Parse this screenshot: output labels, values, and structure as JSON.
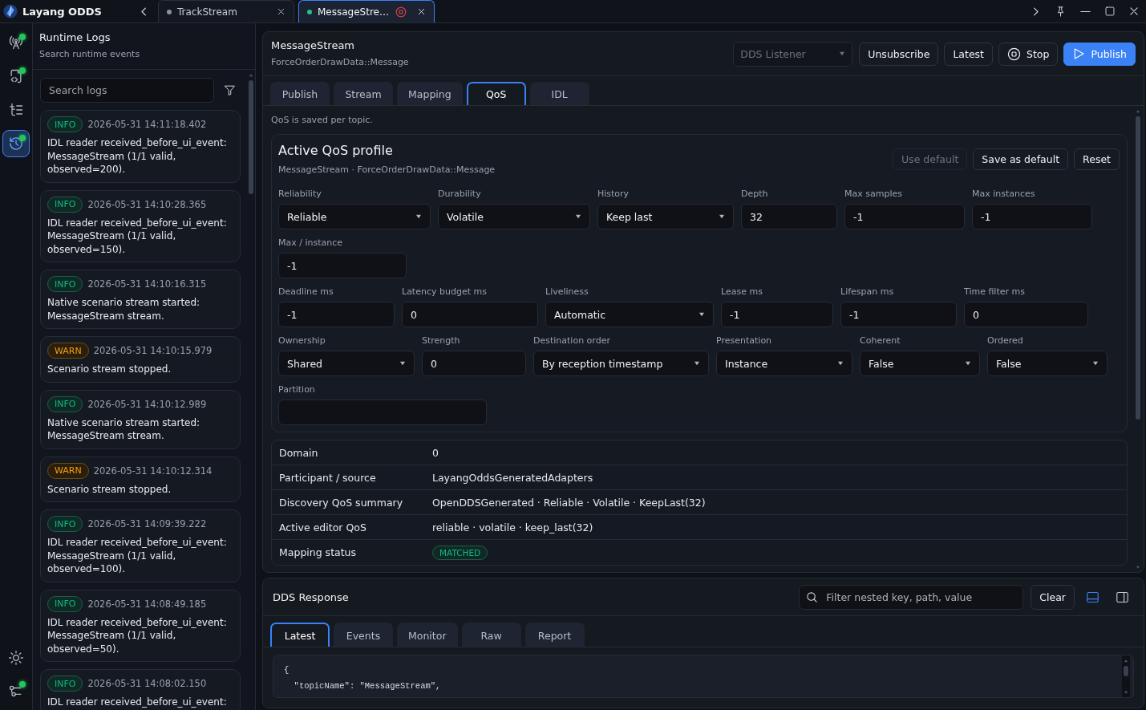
{
  "app": {
    "title": "Layang ODDS"
  },
  "tabs": [
    {
      "label": "TrackStream",
      "selected": false,
      "color": "#8b929e",
      "live": false
    },
    {
      "label": "MessageStre…",
      "selected": true,
      "color": "#22c08a",
      "live": true
    }
  ],
  "rail": {
    "items": [
      {
        "kind": "antenna",
        "selected": false,
        "badge": true
      },
      {
        "kind": "code",
        "selected": false,
        "badge": true
      },
      {
        "kind": "list",
        "selected": false,
        "badge": false
      },
      {
        "kind": "history",
        "selected": true,
        "badge": true
      }
    ],
    "footer": [
      {
        "kind": "settings",
        "selected": false,
        "badge": false
      },
      {
        "kind": "nodes",
        "selected": false,
        "badge": true
      }
    ]
  },
  "logs": {
    "title": "Runtime Logs",
    "subtitle": "Search runtime events",
    "search": {
      "placeholder": "Search logs"
    },
    "entries": [
      {
        "kind": "info",
        "badge": "INFO",
        "time": "2026-05-31 14:11:18.402",
        "message": "IDL reader received_before_ui_event: MessageStream (1/1 valid, observed=200)."
      },
      {
        "kind": "info",
        "badge": "INFO",
        "time": "2026-05-31 14:10:28.365",
        "message": "IDL reader received_before_ui_event: MessageStream (1/1 valid, observed=150)."
      },
      {
        "kind": "info",
        "badge": "INFO",
        "time": "2026-05-31 14:10:16.315",
        "message": "Native scenario stream started: MessageStream stream."
      },
      {
        "kind": "warn",
        "badge": "WARN",
        "time": "2026-05-31 14:10:15.979",
        "message": "Scenario stream stopped."
      },
      {
        "kind": "info",
        "badge": "INFO",
        "time": "2026-05-31 14:10:12.989",
        "message": "Native scenario stream started: MessageStream stream."
      },
      {
        "kind": "warn",
        "badge": "WARN",
        "time": "2026-05-31 14:10:12.314",
        "message": "Scenario stream stopped."
      },
      {
        "kind": "info",
        "badge": "INFO",
        "time": "2026-05-31 14:09:39.222",
        "message": "IDL reader received_before_ui_event: MessageStream (1/1 valid, observed=100)."
      },
      {
        "kind": "info",
        "badge": "INFO",
        "time": "2026-05-31 14:08:49.185",
        "message": "IDL reader received_before_ui_event: MessageStream (1/1 valid, observed=50)."
      },
      {
        "kind": "info",
        "badge": "INFO",
        "time": "2026-05-31 14:08:02.150",
        "message": "IDL reader received_before_ui_event:"
      }
    ]
  },
  "topic": {
    "title": "MessageStream",
    "subtitle": "ForceOrderDrawData::Message",
    "source_select": {
      "value": "DDS Listener",
      "disabled": true
    },
    "actions": [
      {
        "label": "Unsubscribe",
        "kind": "plain"
      },
      {
        "label": "Latest",
        "kind": "plain"
      },
      {
        "label": "Stop",
        "kind": "stop"
      },
      {
        "label": "Publish",
        "kind": "primary"
      }
    ],
    "tabs": [
      {
        "label": "Publish",
        "selected": false
      },
      {
        "label": "Stream",
        "selected": false
      },
      {
        "label": "Mapping",
        "selected": false
      },
      {
        "label": "QoS",
        "selected": true
      },
      {
        "label": "IDL",
        "selected": false
      }
    ],
    "qos": {
      "note": "QoS is saved per topic.",
      "profile": {
        "title": "Active QoS profile",
        "subtitle": "MessageStream · ForceOrderDrawData::Message",
        "buttons": [
          {
            "label": "Use default",
            "disabled": true
          },
          {
            "label": "Save as default",
            "disabled": false
          },
          {
            "label": "Reset",
            "disabled": false
          }
        ],
        "rows": [
          {
            "fields": [
              {
                "label": "Reliability",
                "kind": "select",
                "value": "Reliable"
              },
              {
                "label": "Durability",
                "kind": "select",
                "value": "Volatile"
              },
              {
                "label": "History",
                "kind": "select",
                "value": "Keep last"
              },
              {
                "label": "Depth",
                "kind": "input",
                "value": "32"
              },
              {
                "label": "Max samples",
                "kind": "input",
                "value": "-1"
              },
              {
                "label": "Max instances",
                "kind": "input",
                "value": "-1"
              }
            ]
          },
          {
            "fields": [
              {
                "label": "Max / instance",
                "kind": "input",
                "value": "-1"
              }
            ]
          },
          {
            "fields": [
              {
                "label": "Deadline ms",
                "kind": "input",
                "value": "-1"
              },
              {
                "label": "Latency budget ms",
                "kind": "input",
                "value": "0"
              },
              {
                "label": "Liveliness",
                "kind": "select",
                "value": "Automatic"
              },
              {
                "label": "Lease ms",
                "kind": "input",
                "value": "-1"
              },
              {
                "label": "Lifespan ms",
                "kind": "input",
                "value": "-1"
              },
              {
                "label": "Time filter ms",
                "kind": "input",
                "value": "0"
              }
            ]
          },
          {
            "fields": [
              {
                "label": "Ownership",
                "kind": "select",
                "value": "Shared"
              },
              {
                "label": "Strength",
                "kind": "input",
                "value": "0"
              },
              {
                "label": "Destination order",
                "kind": "select",
                "value": "By reception timestamp"
              },
              {
                "label": "Presentation",
                "kind": "select",
                "value": "Instance"
              },
              {
                "label": "Coherent",
                "kind": "select",
                "value": "False"
              },
              {
                "label": "Ordered",
                "kind": "select",
                "value": "False"
              }
            ]
          },
          {
            "fields": [
              {
                "label": "Partition",
                "kind": "input"
              }
            ]
          }
        ]
      },
      "summary": [
        {
          "label": "Domain",
          "value": "0",
          "kind": "text"
        },
        {
          "label": "Participant / source",
          "value": "LayangOddsGeneratedAdapters",
          "kind": "text"
        },
        {
          "label": "Discovery QoS summary",
          "value": "OpenDDSGenerated · Reliable · Volatile · KeepLast(32)",
          "kind": "text"
        },
        {
          "label": "Active editor QoS",
          "value": "reliable · volatile · keep_last(32)",
          "kind": "text"
        },
        {
          "label": "Mapping status",
          "value": "MATCHED",
          "kind": "badge"
        }
      ]
    }
  },
  "response": {
    "title": "DDS Response",
    "filter": {
      "placeholder": "Filter nested key, path, value"
    },
    "clear": "Clear",
    "layout_buttons": [
      {
        "kind": "bottom",
        "selected": true
      },
      {
        "kind": "right",
        "selected": false
      }
    ],
    "tabs": [
      {
        "label": "Latest",
        "selected": true
      },
      {
        "label": "Events",
        "selected": false
      },
      {
        "label": "Monitor",
        "selected": false
      },
      {
        "label": "Raw",
        "selected": false
      },
      {
        "label": "Report",
        "selected": false
      }
    ],
    "code_lines": [
      "{",
      "  \"topicName\": \"MessageStream\","
    ]
  }
}
